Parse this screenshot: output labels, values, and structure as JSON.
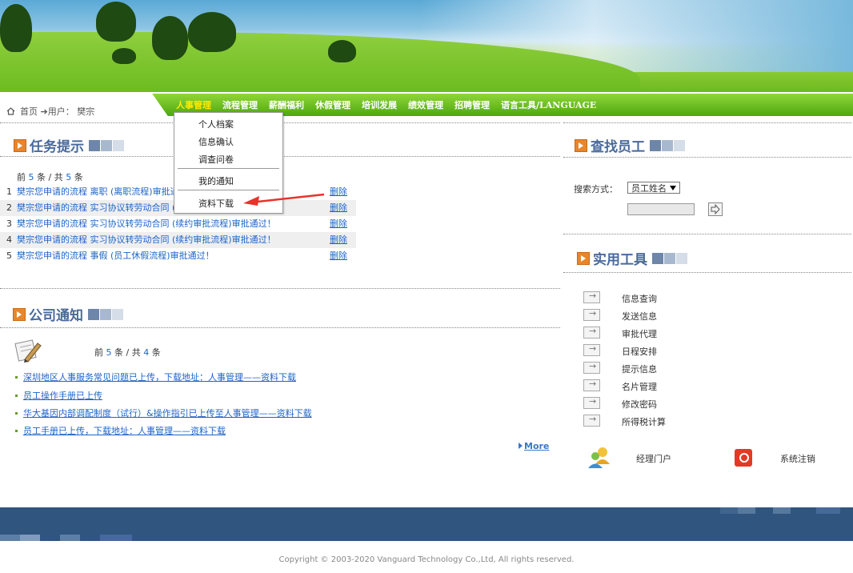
{
  "breadcrumb": {
    "home": "首页",
    "user": "用户：",
    "username": "樊宗"
  },
  "nav": [
    "人事管理",
    "流程管理",
    "薪酬福利",
    "休假管理",
    "培训发展",
    "绩效管理",
    "招聘管理",
    "语言工具/LANGUAGE"
  ],
  "dropdown": [
    "个人档案",
    "信息确认",
    "调查问卷",
    "我的通知",
    "资料下载"
  ],
  "tasks": {
    "title": "任务提示",
    "count_prefix": "前",
    "count_shown": "5",
    "count_mid": "条 / 共",
    "count_total": "5",
    "count_suffix": "条",
    "delete_label": "删除",
    "rows": [
      {
        "n": "1",
        "text": "樊宗您申请的流程 离职 (离职流程)审批通"
      },
      {
        "n": "2",
        "text": "樊宗您申请的流程 实习协议转劳动合同 (绩"
      },
      {
        "n": "3",
        "text": "樊宗您申请的流程 实习协议转劳动合同 (续约审批流程)审批通过！"
      },
      {
        "n": "4",
        "text": "樊宗您申请的流程 实习协议转劳动合同 (续约审批流程)审批通过！"
      },
      {
        "n": "5",
        "text": "樊宗您申请的流程 事假 (员工休假流程)审批通过！"
      }
    ]
  },
  "notices": {
    "title": "公司通知",
    "count_prefix": "前",
    "count_shown": "5",
    "count_mid": "条 / 共",
    "count_total": "4",
    "count_suffix": "条",
    "items": [
      "深圳地区人事服务常见问题已上传，下载地址：人事管理——资料下载",
      "员工操作手册已上传",
      "华大基因内部调配制度（试行）&操作指引已上传至人事管理——资料下载",
      "员工手册已上传，下载地址：人事管理——资料下载"
    ],
    "more": "More"
  },
  "search": {
    "title": "查找员工",
    "label": "搜索方式：",
    "option": "员工姓名"
  },
  "tools": {
    "title": "实用工具",
    "items": [
      "信息查询",
      "发送信息",
      "审批代理",
      "日程安排",
      "提示信息",
      "名片管理",
      "修改密码",
      "所得税计算"
    ]
  },
  "portal_label": "经理门户",
  "logout_label": "系统注销",
  "copyright": "Copyright © 2003-2020 Vanguard Technology Co.,Ltd, All rights reserved."
}
